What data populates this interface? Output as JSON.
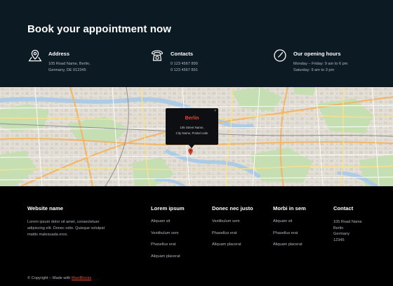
{
  "header": {
    "title": "Book your appointment now"
  },
  "info": [
    {
      "icon": "map-pin-icon",
      "title": "Address",
      "lines": [
        "105 Road Name, Berlin,",
        "Germany, DE 012345"
      ]
    },
    {
      "icon": "phone-icon",
      "title": "Contacts",
      "lines": [
        "0 123 4567 890",
        "0 123 4567 891"
      ]
    },
    {
      "icon": "clock-icon",
      "title": "Our opening hours",
      "lines": [
        "Monday – Friday: 9 am to 6 pm",
        "Saturday: 9 am to 3 pm"
      ]
    }
  ],
  "map": {
    "popup": {
      "title": "Berlin",
      "line1": "105 Street Name,",
      "line2": "City Name, Postal code",
      "close": "×"
    }
  },
  "footer": {
    "about": {
      "heading": "Website name",
      "text": "Lorem ipsum dolor sit amet, consectetuer\nadipiscing elit. Donec odio. Quisque volutpat\nmattis malesuada eros."
    },
    "columns": [
      {
        "heading": "Lorem ipsum",
        "links": [
          "Aliquam sit",
          "Vestibulum sem",
          "Phasellus erat",
          "Aliquam placerat"
        ]
      },
      {
        "heading": "Donec nec justo",
        "links": [
          "Vestibulum sem",
          "Phasellus erat",
          "Aliquam placerat"
        ]
      },
      {
        "heading": "Morbi in sem",
        "links": [
          "Aliquam sit",
          "Phasellus erat",
          "Aliquam placerat"
        ]
      }
    ],
    "contact": {
      "heading": "Contact",
      "lines": [
        "105 Road Name",
        "Berlin",
        "Germany",
        "12345"
      ]
    },
    "copyright": {
      "prefix": "© Copyright – Made with ",
      "brand": "MaxiBlocks"
    }
  },
  "colors": {
    "band_bg": "#0b1a23",
    "footer_bg": "#000000",
    "accent": "#e8452c"
  }
}
